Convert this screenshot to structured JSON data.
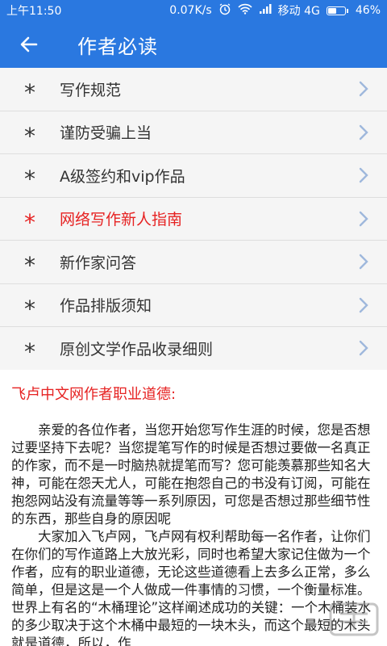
{
  "status_bar": {
    "time": "上午11:50",
    "speed": "0.07K/s",
    "carrier": "移动 4G",
    "battery": "46%",
    "battery_level": 0.46,
    "icons": [
      "alarm-icon",
      "wifi-icon",
      "signal-icon",
      "battery-icon"
    ]
  },
  "app_bar": {
    "title": "作者必读",
    "back_icon": "back-arrow-icon"
  },
  "menu": {
    "bullet": "*",
    "items": [
      {
        "label": "写作规范",
        "active": false
      },
      {
        "label": "谨防受骗上当",
        "active": false
      },
      {
        "label": "A级签约和vip作品",
        "active": false
      },
      {
        "label": "网络写作新人指南",
        "active": true
      },
      {
        "label": "新作家问答",
        "active": false
      },
      {
        "label": "作品排版须知",
        "active": false
      },
      {
        "label": "原创文学作品收录细则",
        "active": false
      }
    ]
  },
  "article": {
    "title": "飞卢中文网作者职业道德:",
    "paragraphs": [
      "亲爱的各位作者，当您开始您写作生涯的时候，您是否想过要坚持下去呢？当您提笔写作的时候是否想过要做一名真正的作家，而不是一时脑热就提笔而写？您可能羡慕那些知名大神，可能在怨天尤人，可能在抱怨自己的书没有订阅，可能在抱怨网站没有流量等等一系列原因，可您是否想过那些细节性的东西，那些自身的原因呢",
      "大家加入飞卢网，飞卢网有权利帮助每一名作者，让你们在你们的写作道路上大放光彩，同时也希望大家记住做为一个作者，应有的职业道德，无论这些道德看上去多么正常，多么简单，但是这是一个人做成一件事情的习惯，一个衡量标准。世界上有名的“木桶理论”这样阐述成功的关键：一个木桶装水的多少取决于这个木桶中最短的一块木头，而这个最短的木头就是道德，所以，作"
    ]
  },
  "colors": {
    "primary": "#2a78e0",
    "accent_red": "#e62222",
    "chevron": "#9fb8dc"
  }
}
